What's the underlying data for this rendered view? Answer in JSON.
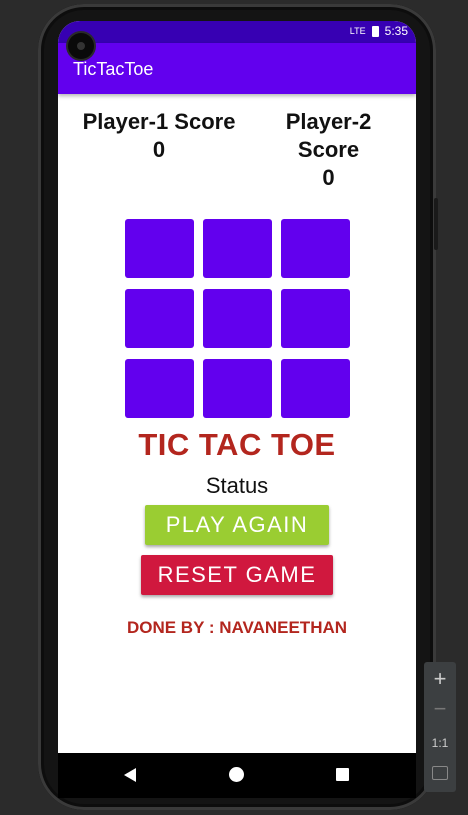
{
  "status_bar": {
    "time": "5:35",
    "network": "LTE"
  },
  "app_bar": {
    "title": "TicTacToe"
  },
  "scores": {
    "player1": {
      "label": "Player-1 Score",
      "value": "0"
    },
    "player2": {
      "label": "Player-2 Score",
      "value": "0"
    }
  },
  "game": {
    "title": "TIC TAC TOE",
    "status": "Status"
  },
  "buttons": {
    "play_again": "PLAY AGAIN",
    "reset_game": "RESET GAME"
  },
  "footer": {
    "credit": "DONE BY : NAVANEETHAN"
  },
  "emulator_controls": {
    "zoom_in": "+",
    "zoom_out": "−",
    "ratio": "1:1"
  },
  "colors": {
    "app_bar": "#6200ee",
    "status_bar": "#3700b3",
    "cell": "#6200ee",
    "title": "#b3261e",
    "play_again": "#9acd32",
    "reset_game": "#d0183e"
  }
}
